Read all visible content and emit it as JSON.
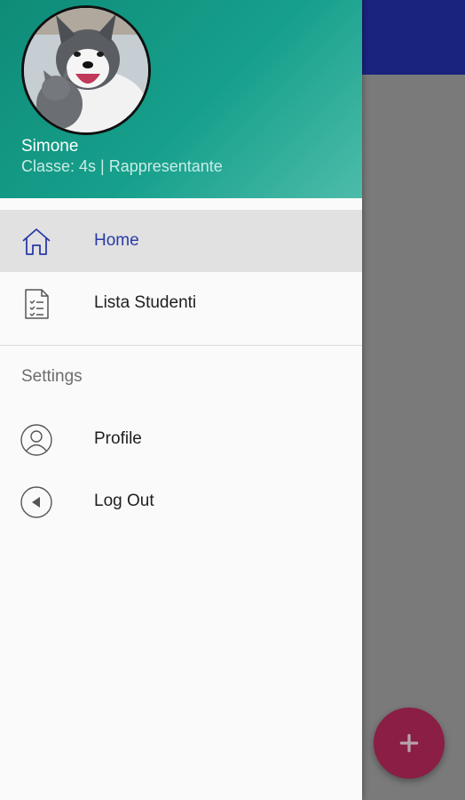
{
  "header": {
    "user_name": "Simone",
    "user_subtitle": "Classe: 4s | Rappresentante",
    "avatar_icon": "dog-avatar"
  },
  "menu": {
    "items": [
      {
        "label": "Home",
        "icon": "home-icon",
        "active": true
      },
      {
        "label": "Lista Studenti",
        "icon": "document-list-icon",
        "active": false
      }
    ],
    "settings_title": "Settings",
    "settings_items": [
      {
        "label": "Profile",
        "icon": "user-circle-icon"
      },
      {
        "label": "Log Out",
        "icon": "back-circle-icon"
      }
    ]
  },
  "fab": {
    "icon": "plus-icon"
  },
  "colors": {
    "header_gradient_start": "#0f8c78",
    "header_gradient_end": "#4dbcaa",
    "active_label": "#2a3aa8",
    "toolbar": "#1a237e",
    "fab": "#8a1e45"
  }
}
